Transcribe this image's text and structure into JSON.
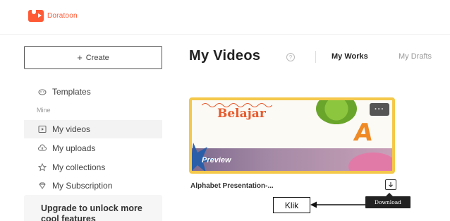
{
  "brand": {
    "name": "Doratoon",
    "color": "#ff5a36"
  },
  "sidebar": {
    "create_label": "Create",
    "items": [
      {
        "label": "Templates",
        "icon": "templates-icon"
      },
      {
        "label": "My videos",
        "icon": "video-icon",
        "active": true
      },
      {
        "label": "My uploads",
        "icon": "cloud-upload-icon"
      },
      {
        "label": "My collections",
        "icon": "star-icon"
      },
      {
        "label": "My Subscription",
        "icon": "diamond-icon"
      }
    ],
    "mine_label": "Mine",
    "upgrade_text": "Upgrade to unlock more cool features"
  },
  "main": {
    "title": "My Videos",
    "tabs": [
      {
        "label": "My Works",
        "active": true
      },
      {
        "label": "My Drafts",
        "active": false
      }
    ]
  },
  "video_card": {
    "thumbnail_text": "Belajar",
    "thumbnail_letter": "A",
    "more_label": "···",
    "preview_label": "Preview",
    "title": "Alphabet Presentation-...",
    "download_tooltip": "Download"
  },
  "annotation": {
    "label": "Klik"
  }
}
